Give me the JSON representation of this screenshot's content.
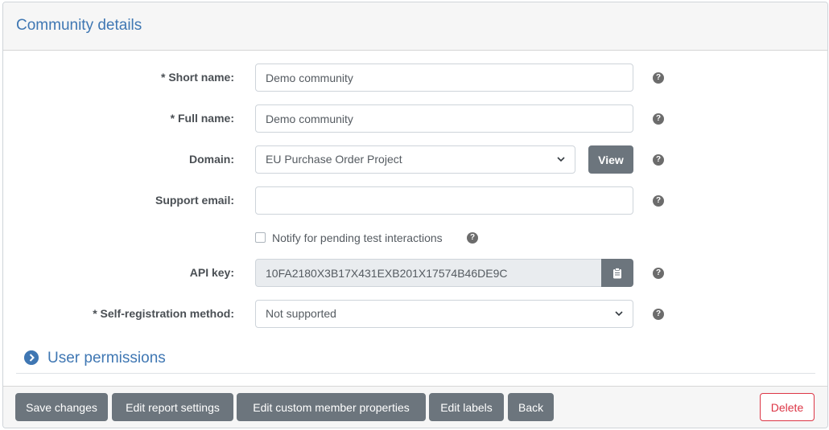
{
  "header": {
    "title": "Community details"
  },
  "form": {
    "short_name": {
      "label": "* Short name:",
      "value": "Demo community"
    },
    "full_name": {
      "label": "* Full name:",
      "value": "Demo community"
    },
    "domain": {
      "label": "Domain:",
      "value": "EU Purchase Order Project",
      "view_label": "View"
    },
    "support_email": {
      "label": "Support email:",
      "value": ""
    },
    "notify": {
      "label": "Notify for pending test interactions",
      "checked": false
    },
    "api_key": {
      "label": "API key:",
      "value": "10FA2180X3B17X431EXB201X17574B46DE9C"
    },
    "self_registration": {
      "label": "* Self-registration method:",
      "value": "Not supported"
    },
    "help_glyph": "?"
  },
  "section": {
    "title": "User permissions"
  },
  "footer": {
    "save_label": "Save changes",
    "edit_report_label": "Edit report settings",
    "edit_custom_label": "Edit custom member properties",
    "edit_labels_label": "Edit labels",
    "back_label": "Back",
    "delete_label": "Delete"
  },
  "colors": {
    "accent": "#3f77b3",
    "button_secondary": "#6c757d",
    "danger": "#dc3545"
  },
  "icons": {
    "help": "question-circle-icon",
    "select": "chevron-down-icon",
    "copy": "clipboard-icon",
    "section": "chevron-right-circle-icon"
  }
}
